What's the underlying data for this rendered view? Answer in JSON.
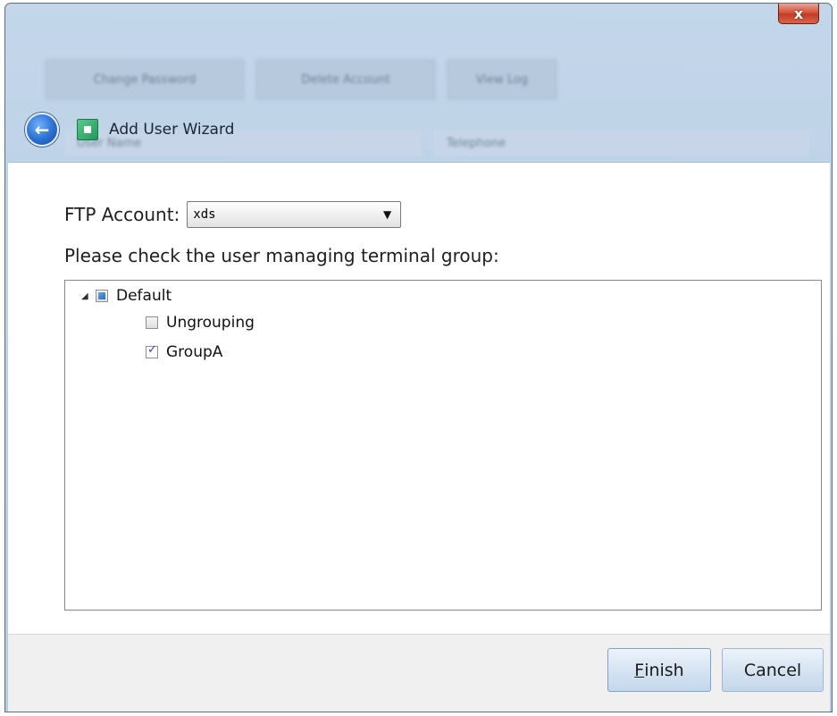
{
  "window": {
    "close_glyph": "x"
  },
  "background_toolbar": [
    "Change Password",
    "Delete Account",
    "View Log"
  ],
  "background_columns": [
    "User Name",
    "Telephone"
  ],
  "wizard": {
    "title": "Add User Wizard"
  },
  "form": {
    "ftp_label": "FTP Account:",
    "ftp_value": "xds",
    "instruction": "Please check the user managing terminal group:"
  },
  "tree": {
    "root": {
      "label": "Default",
      "state": "partial",
      "expanded": true
    },
    "children": [
      {
        "label": "Ungrouping",
        "checked": false
      },
      {
        "label": "GroupA",
        "checked": true
      }
    ]
  },
  "buttons": {
    "finish_mnemonic": "F",
    "finish_rest": "inish",
    "cancel": "Cancel"
  },
  "colors": {
    "window_frame": "#bcd0e6",
    "close_button": "#d7533b",
    "button_face": "#d6e4f2"
  }
}
